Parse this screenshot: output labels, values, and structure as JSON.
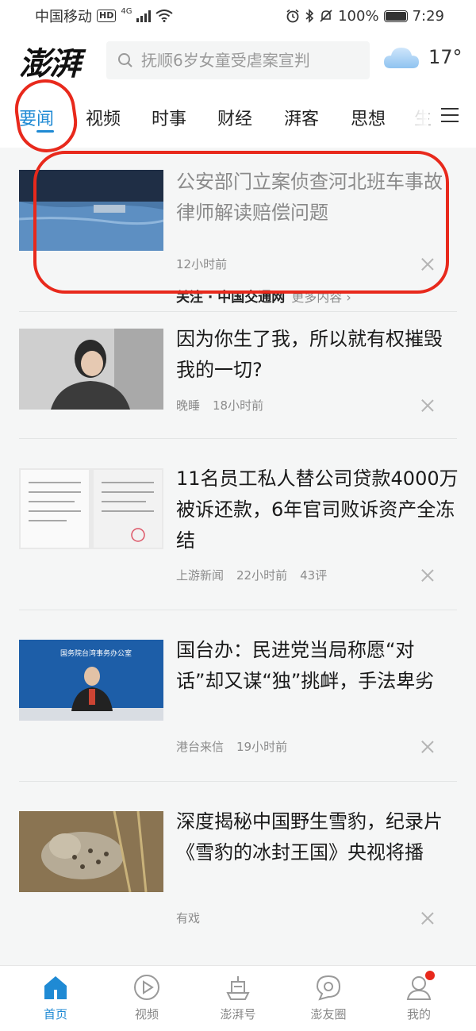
{
  "status_bar": {
    "carrier": "中国移动",
    "hd": "HD",
    "network": "4G",
    "battery": "100%",
    "time": "7:29"
  },
  "header": {
    "logo": "澎湃",
    "search_placeholder": "抚顺6岁女童受虐案宣判",
    "weather_temp": "17°"
  },
  "tabs": [
    "要闻",
    "视频",
    "时事",
    "财经",
    "湃客",
    "思想",
    "生"
  ],
  "feed": [
    {
      "title": "公安部门立案侦查河北班车事故 律师解读赔偿问题",
      "meta": [
        "12小时前"
      ],
      "follow": "关注 · 中国交通网",
      "more": "更多内容 ›"
    },
    {
      "title": "因为你生了我，所以就有权摧毁我的一切?",
      "meta": [
        "晚睡",
        "18小时前"
      ]
    },
    {
      "title": "11名员工私人替公司贷款4000万被诉还款，6年官司败诉资产全冻结",
      "meta": [
        "上游新闻",
        "22小时前",
        "43评"
      ]
    },
    {
      "title": "国台办：民进党当局称愿“对话”却又谋“独”挑衅，手法卑劣",
      "meta": [
        "港台来信",
        "19小时前"
      ],
      "thumb_text": "国务院台湾事务办公室"
    },
    {
      "title": "深度揭秘中国野生雪豹，纪录片《雪豹的冰封王国》央视将播",
      "meta": [
        "有戏"
      ]
    }
  ],
  "bottom_nav": [
    {
      "label": "首页",
      "icon": "home-icon"
    },
    {
      "label": "视频",
      "icon": "play-icon"
    },
    {
      "label": "澎湃号",
      "icon": "ship-icon"
    },
    {
      "label": "澎友圈",
      "icon": "chat-icon"
    },
    {
      "label": "我的",
      "icon": "profile-icon"
    }
  ],
  "colors": {
    "accent": "#1f8ad4",
    "annotation": "#e8291c"
  }
}
